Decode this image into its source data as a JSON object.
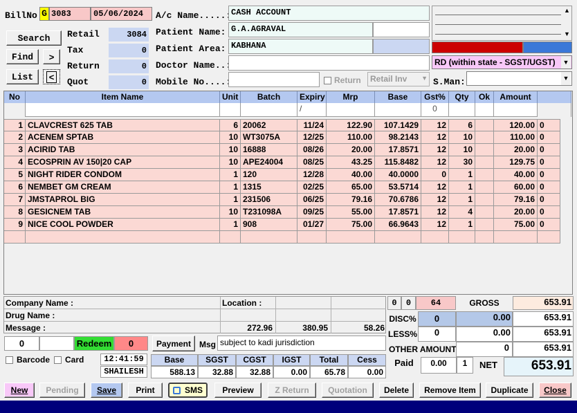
{
  "header": {
    "bill_no_label": "BillNo",
    "bill_series": "G",
    "bill_no": "3083",
    "bill_date": "05/06/2024",
    "search": "Search",
    "find": "Find",
    "next": ">",
    "list": "List",
    "prev": "<",
    "counters": [
      {
        "label": "Retail",
        "value": "3084"
      },
      {
        "label": "Tax",
        "value": "0"
      },
      {
        "label": "Return",
        "value": "0"
      },
      {
        "label": "Quot",
        "value": "0"
      }
    ],
    "ac_name_label": "A/c Name.....:",
    "ac_name": "CASH ACCOUNT",
    "patient_name_label": "Patient Name:",
    "patient_name": "G.A.AGRAVAL",
    "patient_area_label": "Patient Area:",
    "patient_area": "KABHANA",
    "doctor_name_label": "Doctor Name..:",
    "doctor_name": "",
    "mobile_label": "Mobile No....:",
    "mobile": "",
    "return_label": "Return",
    "retail_inv": "Retail Inv",
    "tax_type": "RD (within state - SGST/UGST)",
    "sman_label": "S.Man:",
    "sman": ""
  },
  "grid": {
    "columns": [
      "No",
      "Item Name",
      "Unit",
      "Batch",
      "Expiry",
      "Mrp",
      "Base",
      "Gst%",
      "Qty",
      "Ok",
      "Amount"
    ],
    "entry": {
      "expiry": "/",
      "gst": "0"
    },
    "rows": [
      {
        "no": "1",
        "item": "CLAVCREST 625 TAB",
        "unit": "6",
        "batch": "20062",
        "expiry": "11/24",
        "mrp": "122.90",
        "base": "107.1429",
        "gst": "12",
        "qty": "6",
        "amount": "120.00",
        "extra": "0"
      },
      {
        "no": "2",
        "item": "ACENEM SPTAB",
        "unit": "10",
        "batch": "WT3075A",
        "expiry": "12/25",
        "mrp": "110.00",
        "base": "98.2143",
        "gst": "12",
        "qty": "10",
        "amount": "110.00",
        "extra": "0"
      },
      {
        "no": "3",
        "item": "ACIRID TAB",
        "unit": "10",
        "batch": "16888",
        "expiry": "08/26",
        "mrp": "20.00",
        "base": "17.8571",
        "gst": "12",
        "qty": "10",
        "amount": "20.00",
        "extra": "0"
      },
      {
        "no": "4",
        "item": "ECOSPRIN AV 150|20 CAP",
        "unit": "10",
        "batch": "APE24004",
        "expiry": "08/25",
        "mrp": "43.25",
        "base": "115.8482",
        "gst": "12",
        "qty": "30",
        "amount": "129.75",
        "extra": "0"
      },
      {
        "no": "5",
        "item": "NIGHT RIDER CONDOM",
        "unit": "1",
        "batch": "120",
        "expiry": "12/28",
        "mrp": "40.00",
        "base": "40.0000",
        "gst": "0",
        "qty": "1",
        "amount": "40.00",
        "extra": "0"
      },
      {
        "no": "6",
        "item": "NEMBET GM CREAM",
        "unit": "1",
        "batch": "1315",
        "expiry": "02/25",
        "mrp": "65.00",
        "base": "53.5714",
        "gst": "12",
        "qty": "1",
        "amount": "60.00",
        "extra": "0"
      },
      {
        "no": "7",
        "item": "JMSTAPROL BIG",
        "unit": "1",
        "batch": "231506",
        "expiry": "06/25",
        "mrp": "79.16",
        "base": "70.6786",
        "gst": "12",
        "qty": "1",
        "amount": "79.16",
        "extra": "0"
      },
      {
        "no": "8",
        "item": "GESICNEM TAB",
        "unit": "10",
        "batch": "T231098A",
        "expiry": "09/25",
        "mrp": "55.00",
        "base": "17.8571",
        "gst": "12",
        "qty": "4",
        "amount": "20.00",
        "extra": "0"
      },
      {
        "no": "9",
        "item": "NICE COOL POWDER",
        "unit": "1",
        "batch": "908",
        "expiry": "01/27",
        "mrp": "75.00",
        "base": "66.9643",
        "gst": "12",
        "qty": "1",
        "amount": "75.00",
        "extra": "0"
      }
    ]
  },
  "info": {
    "company_label": "Company Name :",
    "drug_label": "Drug Name :",
    "message_label": "Message :",
    "location_label": "Location :",
    "v1": "272.96",
    "v2": "380.95",
    "v3": "58.26",
    "redeem_left": "0",
    "redeem_label": "Redeem",
    "redeem_right": "0",
    "payment": "Payment",
    "msg_label": "Msg",
    "msg": "subject to kadi jurisdiction",
    "barcode": "Barcode",
    "card": "Card",
    "time": "12:41:59",
    "user": "SHAILESH"
  },
  "tax_summary": {
    "headers": [
      "Base",
      "SGST",
      "CGST",
      "IGST",
      "Total",
      "Cess"
    ],
    "values": [
      "588.13",
      "32.88",
      "32.88",
      "0.00",
      "65.78",
      "0.00"
    ]
  },
  "totals": {
    "c1": "0",
    "c2": "0",
    "c3": "64",
    "gross_label": "GROSS",
    "gross": "653.91",
    "disc_label": "DISC%",
    "disc_pct": "0",
    "disc_amt": "0.00",
    "disc_total": "653.91",
    "less_label": "LESS%",
    "less_pct": "0",
    "less_amt": "0.00",
    "less_total": "653.91",
    "other_label": "OTHER AMOUNT",
    "other_amt": "0",
    "other_total": "653.91",
    "paid_label": "Paid",
    "paid": "0.00",
    "paid_count": "1",
    "net_label": "NET",
    "net": "653.91"
  },
  "toolbar": {
    "new": "New",
    "pending": "Pending",
    "save": "Save",
    "print": "Print",
    "sms": "SMS",
    "preview": "Preview",
    "zreturn": "Z Return",
    "quotation": "Quotation",
    "delete": "Delete",
    "remove": "Remove Item",
    "duplicate": "Duplicate",
    "close": "Close"
  },
  "colors": {
    "grid_header": "#b4c8f0",
    "row_bg": "#fbd9d4",
    "status_bar": "#00007b",
    "redeem_green": "#33dd33",
    "red_bar": "#cc0000",
    "blue_bar": "#3a78d8"
  }
}
